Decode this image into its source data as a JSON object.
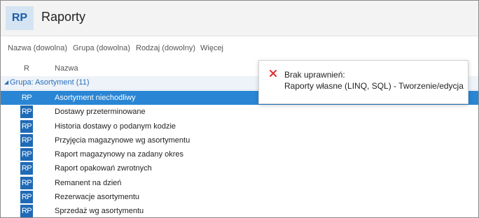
{
  "app": {
    "badge": "RP",
    "title": "Raporty"
  },
  "filters": {
    "items": [
      "Nazwa (dowolna)",
      "Grupa (dowolna)",
      "Rodzaj (dowolny)",
      "Więcej"
    ]
  },
  "columns": {
    "r": "R",
    "name": "Nazwa"
  },
  "group": {
    "label": "Grupa: Asortyment (11)"
  },
  "rows": [
    {
      "icon": "RP",
      "name": "Asortyment niechodliwy",
      "selected": true
    },
    {
      "icon": "RP",
      "name": "Dostawy przeterminowane"
    },
    {
      "icon": "RP",
      "name": "Historia dostawy o podanym kodzie"
    },
    {
      "icon": "RP",
      "name": "Przyjęcia magazynowe wg asortymentu"
    },
    {
      "icon": "RP",
      "name": "Raport magazynowy na zadany okres"
    },
    {
      "icon": "RP",
      "name": "Raport opakowań zwrotnych"
    },
    {
      "icon": "RP",
      "name": "Remanent na dzień"
    },
    {
      "icon": "RP",
      "name": "Rezerwacje asortymentu"
    },
    {
      "icon": "RP",
      "name": "Sprzedaż wg asortymentu"
    }
  ],
  "toast": {
    "line1": "Brak uprawnień:",
    "line2": "Raporty własne (LINQ, SQL) - Tworzenie/edycja",
    "icon": "error-x-icon",
    "icon_color": "#e0302f"
  },
  "colors": {
    "accent": "#2a86d4",
    "badge_bg": "#d4e4f3",
    "badge_text": "#1c5fa8",
    "rp_icon_bg": "#1f6ab6",
    "group_text": "#2a6ebb"
  }
}
